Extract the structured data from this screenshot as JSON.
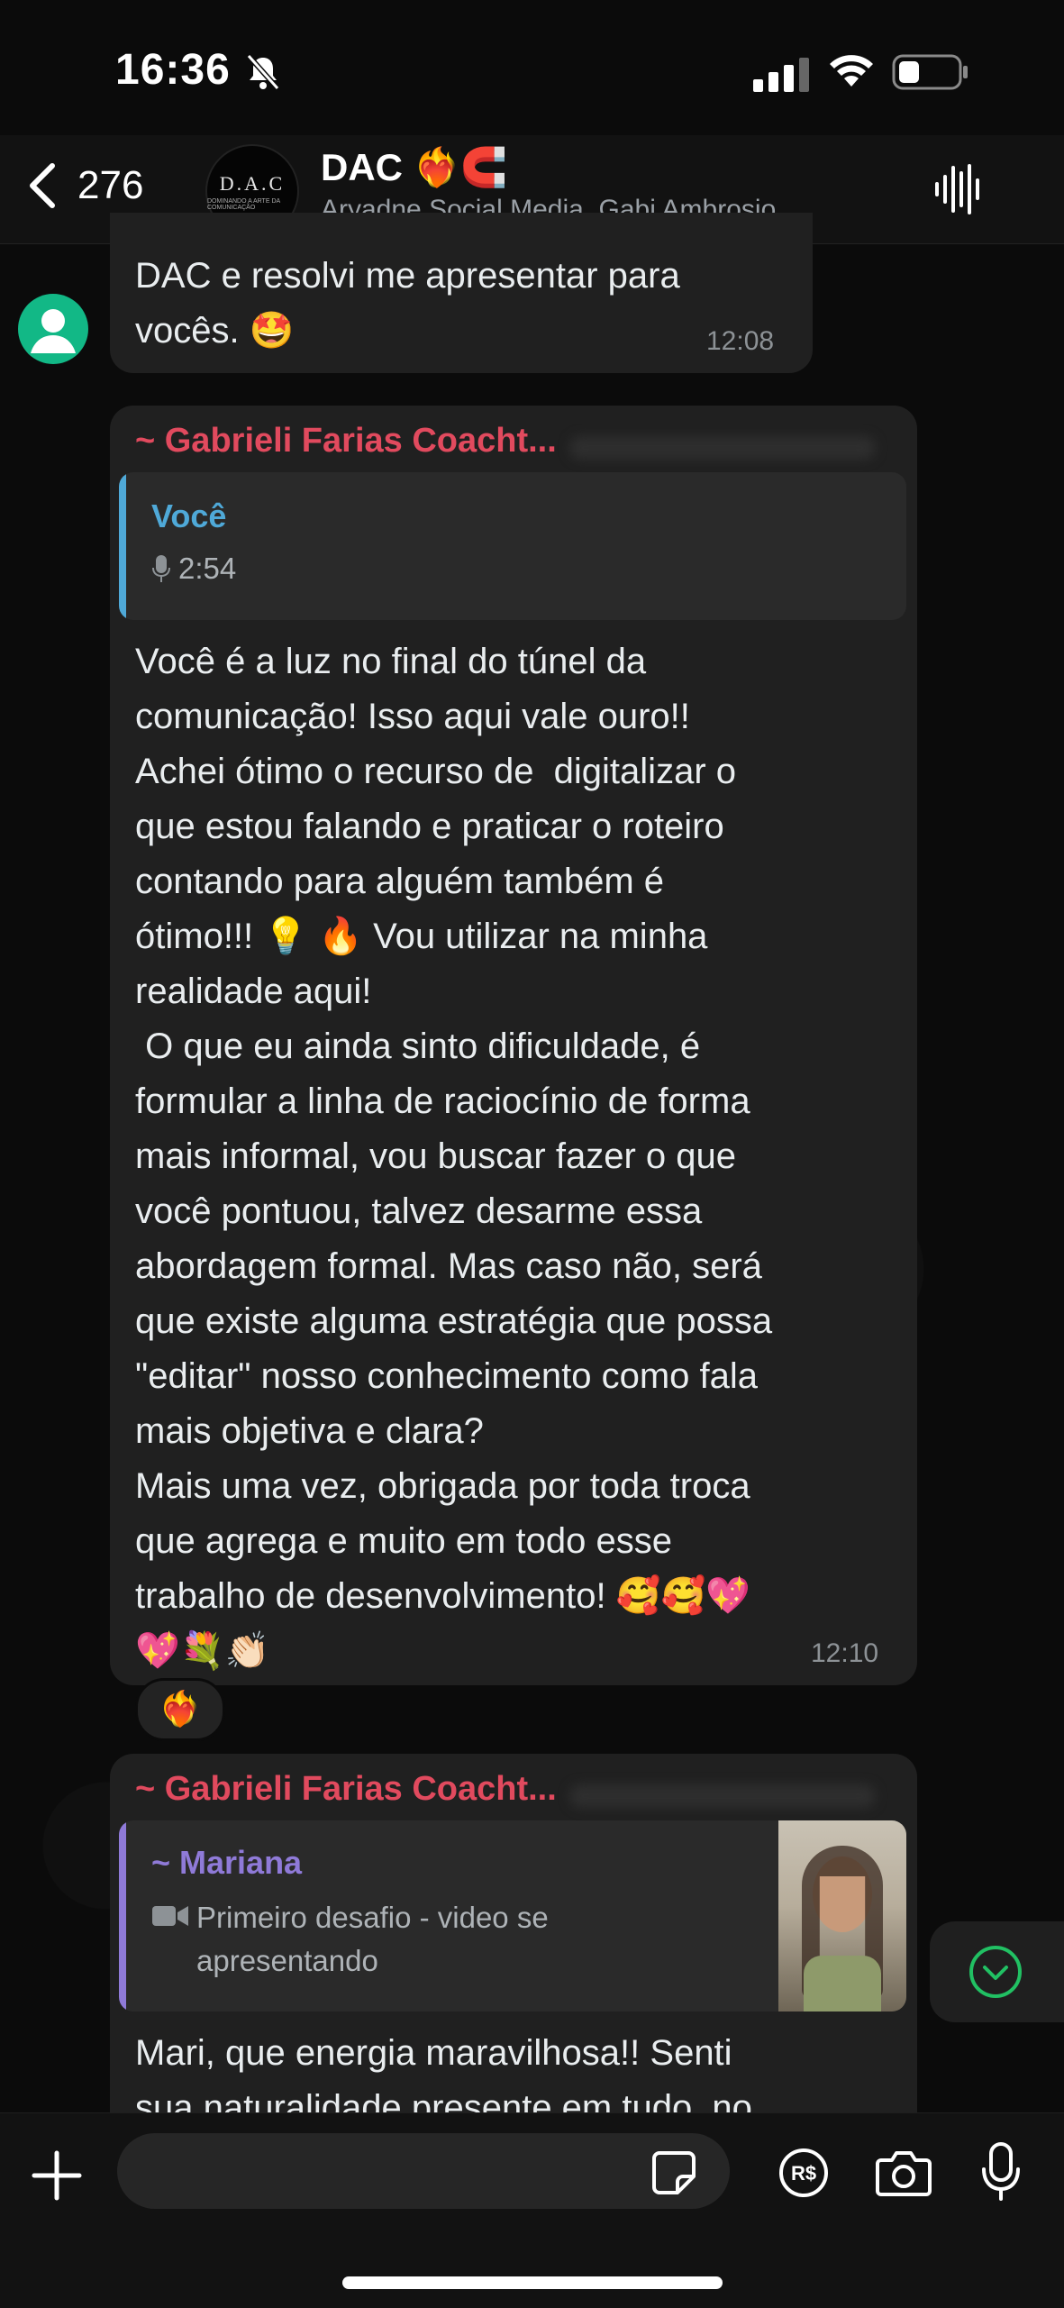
{
  "status_bar": {
    "time": "16:36"
  },
  "header": {
    "back_count": "276",
    "group_avatar_text": "D.A.C",
    "group_avatar_subtext": "DOMINANDO A ARTE DA COMUNICAÇÃO",
    "title": "DAC ❤️‍🔥🧲",
    "members": "Aryadne Social Media, Gabi Ambrosio,..."
  },
  "messages": [
    {
      "text": "DAC e resolvi me apresentar para\nvocês. 🤩",
      "time": "12:08"
    },
    {
      "sender": "~ Gabrieli Farias Coacht...",
      "quote_author": "Você",
      "quote_detail": "2:54",
      "text": "Você é a luz no final do túnel da\ncomunicação! Isso aqui vale ouro!!\nAchei ótimo o recurso de  digitalizar o\nque estou falando e praticar o roteiro\ncontando para alguém também é\nótimo!!! 💡 🔥 Vou utilizar na minha\nrealidade aqui!\n O que eu ainda sinto dificuldade, é\nformular a linha de raciocínio de forma\nmais informal, vou buscar fazer o que\nvocê pontuou, talvez desarme essa\nabordagem formal. Mas caso não, será\nque existe alguma estratégia que possa\n\"editar\" nosso conhecimento como fala\nmais objetiva e clara?\nMais uma vez, obrigada por toda troca\nque agrega e muito em todo esse\ntrabalho de desenvolvimento! 🥰🥰💖\n💖💐👏🏻",
      "time": "12:10",
      "reaction": "❤️‍🔥"
    },
    {
      "sender": "~ Gabrieli Farias Coacht...",
      "quote_author": "~ Mariana",
      "quote_detail": "Primeiro desafio - video se\napresentando",
      "text": "Mari, que energia maravilhosa!! Senti\nsua naturalidade presente em tudo, no"
    }
  ],
  "input": {
    "placeholder": ""
  },
  "colors": {
    "sender": "#e14a5e",
    "quote_bar_self": "#4fa9d8",
    "quote_bar_other": "#8f7ad8",
    "accent_green": "#21c063"
  },
  "icons": [
    "back-chevron-icon",
    "voice-chat-icon",
    "plus-icon",
    "sticker-icon",
    "payment-icon",
    "camera-icon",
    "mic-icon",
    "scroll-down-icon",
    "video-icon",
    "mic-small-icon"
  ]
}
